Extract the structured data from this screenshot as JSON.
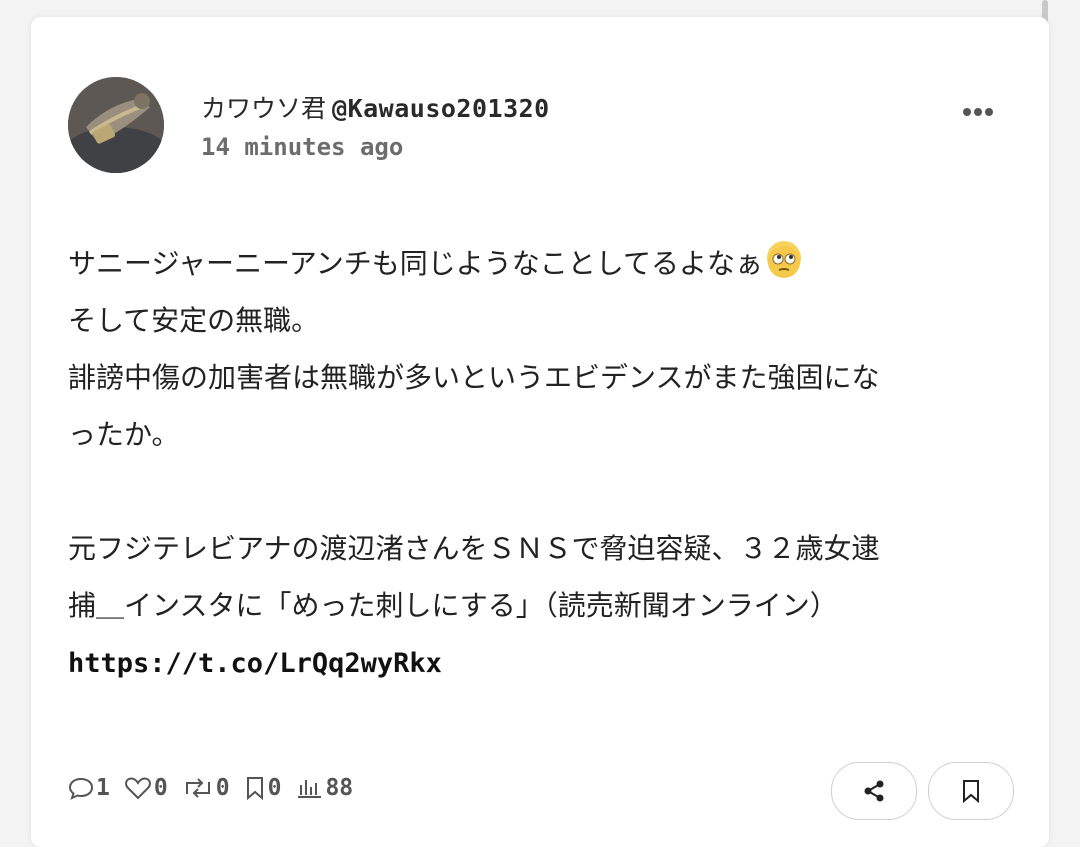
{
  "post": {
    "display_name": "カワウソ君",
    "handle": "@Kawauso201320",
    "time": "14 minutes ago",
    "lines": [
      "サニージャーニーアンチも同じようなことしてるよなぁ",
      "そして安定の無職。",
      "誹謗中傷の加害者は無職が多いというエビデンスがまた強固にな",
      "ったか。",
      "",
      "元フジテレビアナの渡辺渚さんをＳＮＳで脅迫容疑、３２歳女逮",
      "捕＿インスタに「めった刺しにする」（読売新聞オンライン）"
    ],
    "emoji": "face-with-rolling-eyes",
    "link": "https://t.co/LrQq2wyRkx"
  },
  "stats": {
    "replies": "1",
    "likes": "0",
    "reposts": "0",
    "bookmarks": "0",
    "views": "88"
  },
  "colors": {
    "background": "#f3f3f3",
    "card": "#ffffff",
    "text": "#222222",
    "muted": "#6c6c6c"
  }
}
